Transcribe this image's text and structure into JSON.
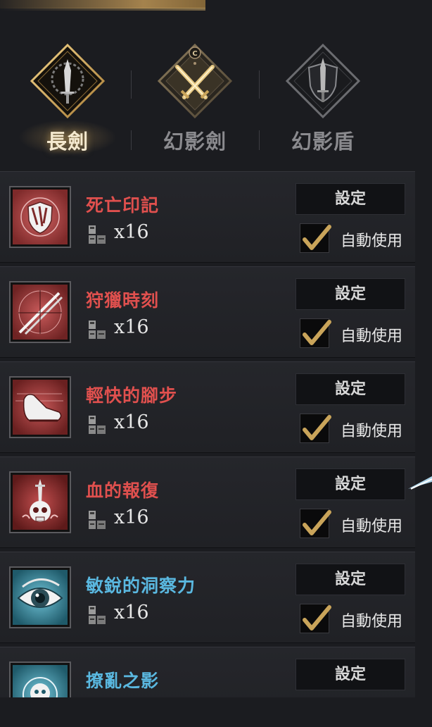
{
  "tabs": [
    {
      "label": "長劍",
      "icon": "long-sword-emblem-icon",
      "active": true
    },
    {
      "label": "幻影劍",
      "icon": "phantom-sword-emblem-icon",
      "active": false
    },
    {
      "label": "幻影盾",
      "icon": "phantom-shield-emblem-icon",
      "active": false
    }
  ],
  "skills": [
    {
      "name": "死亡印記",
      "color": "#e0504e",
      "quantity": "x16",
      "set_label": "設定",
      "auto_label": "自動使用",
      "auto_checked": true,
      "icon": "death-mark-icon"
    },
    {
      "name": "狩獵時刻",
      "color": "#e0504e",
      "quantity": "x16",
      "set_label": "設定",
      "auto_label": "自動使用",
      "auto_checked": true,
      "icon": "hunting-moment-icon"
    },
    {
      "name": "輕快的腳步",
      "color": "#e0504e",
      "quantity": "x16",
      "set_label": "設定",
      "auto_label": "自動使用",
      "auto_checked": true,
      "icon": "light-steps-icon"
    },
    {
      "name": "血的報復",
      "color": "#e0504e",
      "quantity": "x16",
      "set_label": "設定",
      "auto_label": "自動使用",
      "auto_checked": true,
      "icon": "blood-revenge-icon"
    },
    {
      "name": "敏銳的洞察力",
      "color": "#5ab8e0",
      "quantity": "x16",
      "set_label": "設定",
      "auto_label": "自動使用",
      "auto_checked": true,
      "icon": "keen-insight-icon"
    },
    {
      "name": "撩亂之影",
      "color": "#5ab8e0",
      "set_label": "設定",
      "icon": "dazzling-shadow-icon"
    }
  ],
  "colors": {
    "accent_gold": "#c9a45a",
    "red_skill": "#e0504e",
    "blue_skill": "#5ab8e0"
  }
}
